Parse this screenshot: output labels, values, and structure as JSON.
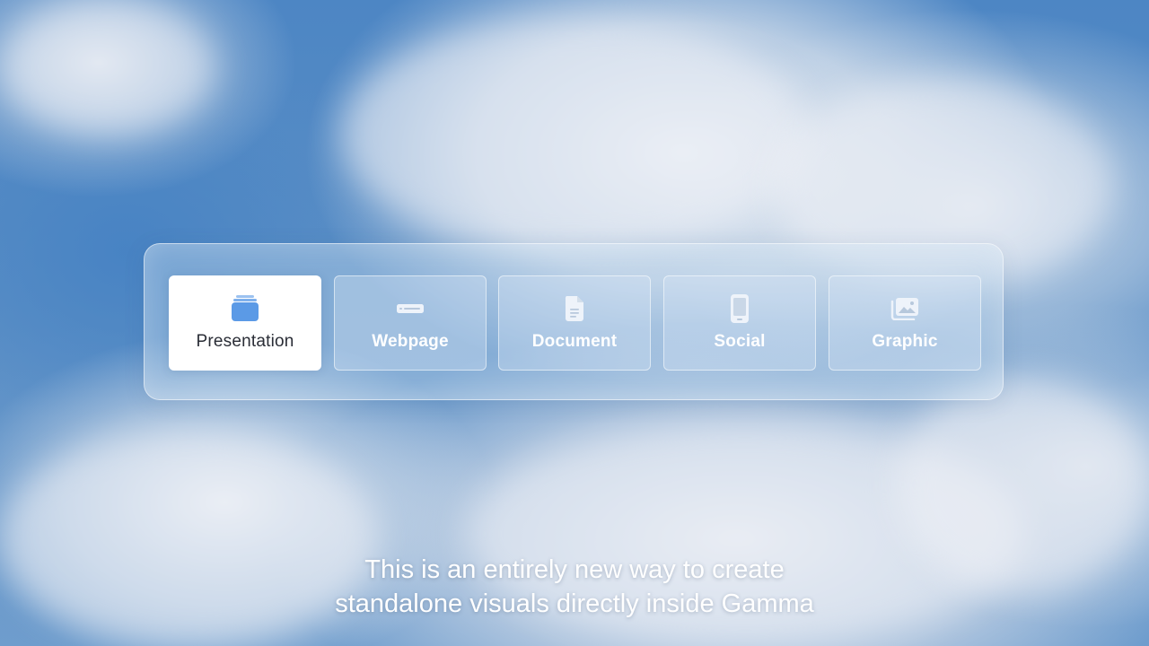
{
  "options": [
    {
      "label": "Presentation",
      "icon": "presentation-icon",
      "selected": true
    },
    {
      "label": "Webpage",
      "icon": "webpage-icon",
      "selected": false
    },
    {
      "label": "Document",
      "icon": "document-icon",
      "selected": false
    },
    {
      "label": "Social",
      "icon": "phone-icon",
      "selected": false
    },
    {
      "label": "Graphic",
      "icon": "image-icon",
      "selected": false
    }
  ],
  "caption": {
    "line1": "This is an entirely new way to create",
    "line2": "standalone visuals directly inside Gamma"
  },
  "colors": {
    "accent": "#5b9ae6",
    "selected_bg": "#ffffff",
    "icon_light": "#eef3fa"
  }
}
